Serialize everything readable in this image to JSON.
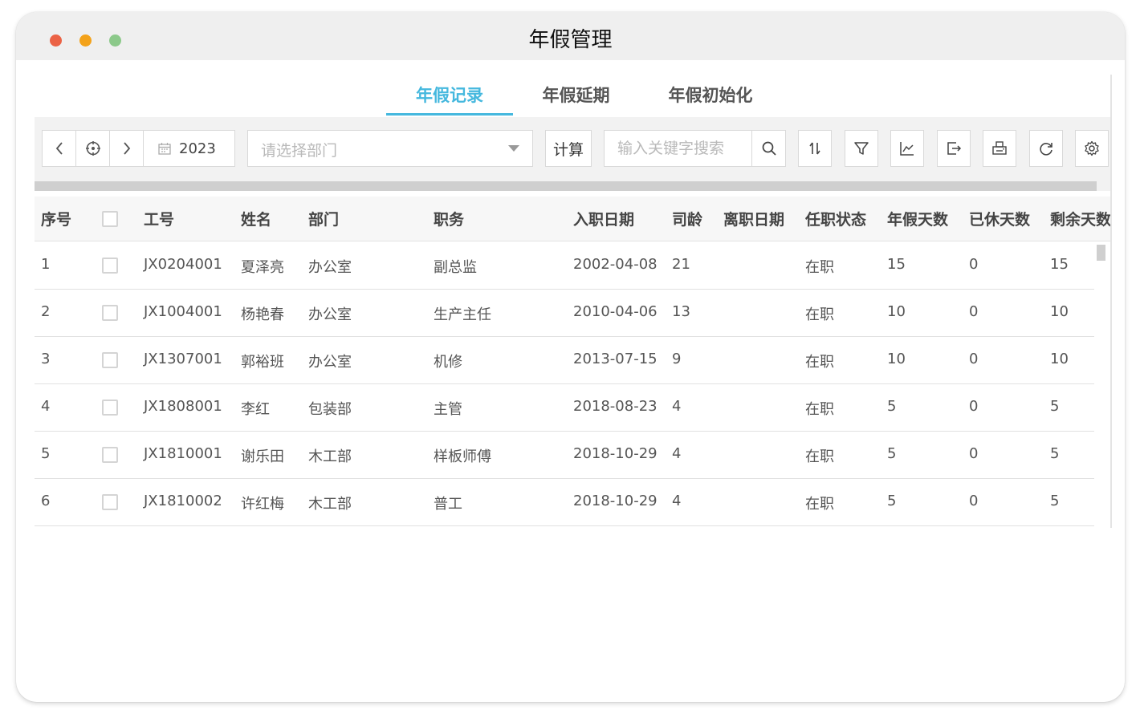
{
  "window": {
    "title": "年假管理"
  },
  "tabs": [
    {
      "label": "年假记录",
      "active": true
    },
    {
      "label": "年假延期",
      "active": false
    },
    {
      "label": "年假初始化",
      "active": false
    }
  ],
  "toolbar": {
    "year": "2023",
    "dept_placeholder": "请选择部门",
    "calc_label": "计算",
    "search_placeholder": "输入关键字搜索",
    "icons": [
      "sort-icon",
      "filter-icon",
      "chart-icon",
      "export-icon",
      "print-icon",
      "refresh-icon",
      "settings-icon"
    ]
  },
  "table": {
    "headers": {
      "index": "序号",
      "emp_id": "工号",
      "name": "姓名",
      "dept": "部门",
      "position": "职务",
      "hire_date": "入职日期",
      "seniority": "司龄",
      "leave_date": "离职日期",
      "status": "任职状态",
      "annual_days": "年假天数",
      "used_days": "已休天数",
      "remaining_days": "剩余天数"
    },
    "rows": [
      {
        "index": "1",
        "emp_id": "JX0204001",
        "name": "夏泽亮",
        "dept": "办公室",
        "position": "副总监",
        "hire_date": "2002-04-08",
        "seniority": "21",
        "leave_date": "",
        "status": "在职",
        "annual_days": "15",
        "used_days": "0",
        "remaining_days": "15"
      },
      {
        "index": "2",
        "emp_id": "JX1004001",
        "name": "杨艳春",
        "dept": "办公室",
        "position": "生产主任",
        "hire_date": "2010-04-06",
        "seniority": "13",
        "leave_date": "",
        "status": "在职",
        "annual_days": "10",
        "used_days": "0",
        "remaining_days": "10"
      },
      {
        "index": "3",
        "emp_id": "JX1307001",
        "name": "郭裕班",
        "dept": "办公室",
        "position": "机修",
        "hire_date": "2013-07-15",
        "seniority": "9",
        "leave_date": "",
        "status": "在职",
        "annual_days": "10",
        "used_days": "0",
        "remaining_days": "10"
      },
      {
        "index": "4",
        "emp_id": "JX1808001",
        "name": "李红",
        "dept": "包装部",
        "position": "主管",
        "hire_date": "2018-08-23",
        "seniority": "4",
        "leave_date": "",
        "status": "在职",
        "annual_days": "5",
        "used_days": "0",
        "remaining_days": "5"
      },
      {
        "index": "5",
        "emp_id": "JX1810001",
        "name": "谢乐田",
        "dept": "木工部",
        "position": "样板师傅",
        "hire_date": "2018-10-29",
        "seniority": "4",
        "leave_date": "",
        "status": "在职",
        "annual_days": "5",
        "used_days": "0",
        "remaining_days": "5"
      },
      {
        "index": "6",
        "emp_id": "JX1810002",
        "name": "许红梅",
        "dept": "木工部",
        "position": "普工",
        "hire_date": "2018-10-29",
        "seniority": "4",
        "leave_date": "",
        "status": "在职",
        "annual_days": "5",
        "used_days": "0",
        "remaining_days": "5"
      }
    ]
  },
  "colors": {
    "accent": "#45b8de",
    "traffic_red": "#eb6245",
    "traffic_yellow": "#f3a21a",
    "traffic_green": "#8cc98a"
  }
}
